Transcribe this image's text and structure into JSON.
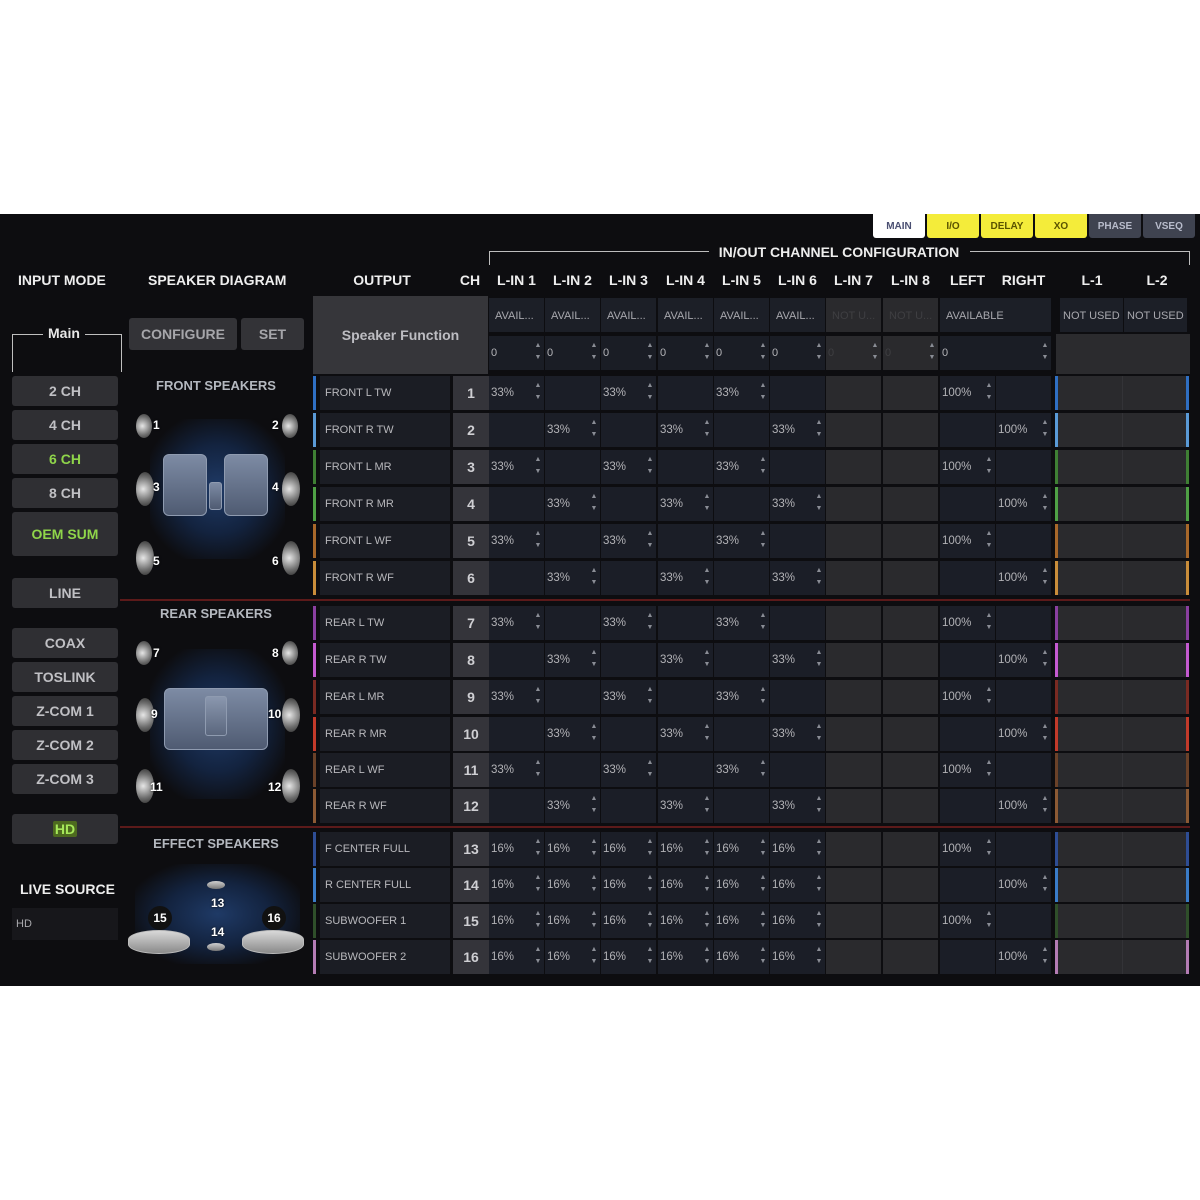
{
  "tabs": [
    {
      "label": "MAIN",
      "style": "white"
    },
    {
      "label": "I/O",
      "style": "yellow"
    },
    {
      "label": "DELAY",
      "style": "yellow"
    },
    {
      "label": "XO",
      "style": "yellow"
    },
    {
      "label": "PHASE",
      "style": "grey"
    },
    {
      "label": "VSEQ",
      "style": "grey"
    }
  ],
  "headers": {
    "input_mode": "INPUT MODE",
    "speaker_diagram": "SPEAKER DIAGRAM",
    "output": "OUTPUT",
    "ch": "CH",
    "inout_config": "IN/OUT CHANNEL CONFIGURATION",
    "speaker_function": "Speaker Function"
  },
  "input_mode": {
    "group_label": "Main",
    "buttons": [
      {
        "label": "2 CH",
        "active": false
      },
      {
        "label": "4 CH",
        "active": false
      },
      {
        "label": "6 CH",
        "active": true
      },
      {
        "label": "8 CH",
        "active": false
      },
      {
        "label": "OEM SUM",
        "active": true
      },
      {
        "label": "LINE",
        "active": false
      },
      {
        "label": "COAX",
        "active": false
      },
      {
        "label": "TOSLINK",
        "active": false
      },
      {
        "label": "Z-COM 1",
        "active": false
      },
      {
        "label": "Z-COM 2",
        "active": false
      },
      {
        "label": "Z-COM 3",
        "active": false
      },
      {
        "label": "HD",
        "active": true
      }
    ],
    "live_source_label": "LIVE SOURCE",
    "live_source_value": "HD"
  },
  "speaker_diagram": {
    "configure_label": "CONFIGURE",
    "set_label": "SET",
    "front_label": "FRONT SPEAKERS",
    "rear_label": "REAR SPEAKERS",
    "effect_label": "EFFECT SPEAKERS",
    "front_numbers": [
      "1",
      "2",
      "3",
      "4",
      "5",
      "6"
    ],
    "rear_numbers": [
      "7",
      "8",
      "9",
      "10",
      "11",
      "12"
    ],
    "effect_numbers": [
      "13",
      "14",
      "15",
      "16"
    ]
  },
  "input_columns": [
    {
      "label": "L-IN 1",
      "status": "AVAIL...",
      "value": "0",
      "enabled": true
    },
    {
      "label": "L-IN 2",
      "status": "AVAIL...",
      "value": "0",
      "enabled": true
    },
    {
      "label": "L-IN 3",
      "status": "AVAIL...",
      "value": "0",
      "enabled": true
    },
    {
      "label": "L-IN 4",
      "status": "AVAIL...",
      "value": "0",
      "enabled": true
    },
    {
      "label": "L-IN 5",
      "status": "AVAIL...",
      "value": "0",
      "enabled": true
    },
    {
      "label": "L-IN 6",
      "status": "AVAIL...",
      "value": "0",
      "enabled": true
    },
    {
      "label": "L-IN 7",
      "status": "NOT U...",
      "value": "0",
      "enabled": false
    },
    {
      "label": "L-IN 8",
      "status": "NOT U...",
      "value": "0",
      "enabled": false
    }
  ],
  "left_right": {
    "left_label": "LEFT",
    "right_label": "RIGHT",
    "status": "AVAILABLE",
    "value": "0"
  },
  "link_columns": [
    {
      "label": "L-1",
      "status": "NOT USED"
    },
    {
      "label": "L-2",
      "status": "NOT USED"
    }
  ],
  "rows": [
    {
      "name": "FRONT L TW",
      "ch": "1",
      "color": "#2f6fc2",
      "inputs": [
        "33%",
        "",
        "33%",
        "",
        "33%",
        "",
        "",
        ""
      ],
      "left": "100%",
      "right": ""
    },
    {
      "name": "FRONT R TW",
      "ch": "2",
      "color": "#5a9ad6",
      "inputs": [
        "",
        "33%",
        "",
        "33%",
        "",
        "33%",
        "",
        ""
      ],
      "left": "",
      "right": "100%"
    },
    {
      "name": "FRONT L MR",
      "ch": "3",
      "color": "#3f7f34",
      "inputs": [
        "33%",
        "",
        "33%",
        "",
        "33%",
        "",
        "",
        ""
      ],
      "left": "100%",
      "right": ""
    },
    {
      "name": "FRONT R MR",
      "ch": "4",
      "color": "#4fa045",
      "inputs": [
        "",
        "33%",
        "",
        "33%",
        "",
        "33%",
        "",
        ""
      ],
      "left": "",
      "right": "100%"
    },
    {
      "name": "FRONT L WF",
      "ch": "5",
      "color": "#a8682a",
      "inputs": [
        "33%",
        "",
        "33%",
        "",
        "33%",
        "",
        "",
        ""
      ],
      "left": "100%",
      "right": ""
    },
    {
      "name": "FRONT R WF",
      "ch": "6",
      "color": "#c98d3a",
      "inputs": [
        "",
        "33%",
        "",
        "33%",
        "",
        "33%",
        "",
        ""
      ],
      "left": "",
      "right": "100%"
    },
    {
      "name": "REAR L TW",
      "ch": "7",
      "color": "#8a3fa0",
      "inputs": [
        "33%",
        "",
        "33%",
        "",
        "33%",
        "",
        "",
        ""
      ],
      "left": "100%",
      "right": ""
    },
    {
      "name": "REAR R TW",
      "ch": "8",
      "color": "#c45ad0",
      "inputs": [
        "",
        "33%",
        "",
        "33%",
        "",
        "33%",
        "",
        ""
      ],
      "left": "",
      "right": "100%"
    },
    {
      "name": "REAR L MR",
      "ch": "9",
      "color": "#7a2a22",
      "inputs": [
        "33%",
        "",
        "33%",
        "",
        "33%",
        "",
        "",
        ""
      ],
      "left": "100%",
      "right": ""
    },
    {
      "name": "REAR R MR",
      "ch": "10",
      "color": "#c23a2a",
      "inputs": [
        "",
        "33%",
        "",
        "33%",
        "",
        "33%",
        "",
        ""
      ],
      "left": "",
      "right": "100%"
    },
    {
      "name": "REAR L WF",
      "ch": "11",
      "color": "#6a4128",
      "inputs": [
        "33%",
        "",
        "33%",
        "",
        "33%",
        "",
        "",
        ""
      ],
      "left": "100%",
      "right": ""
    },
    {
      "name": "REAR R WF",
      "ch": "12",
      "color": "#8c5a34",
      "inputs": [
        "",
        "33%",
        "",
        "33%",
        "",
        "33%",
        "",
        ""
      ],
      "left": "",
      "right": "100%"
    },
    {
      "name": "F CENTER FULL",
      "ch": "13",
      "color": "#2e4d94",
      "inputs": [
        "16%",
        "16%",
        "16%",
        "16%",
        "16%",
        "16%",
        "",
        ""
      ],
      "left": "100%",
      "right": ""
    },
    {
      "name": "R CENTER FULL",
      "ch": "14",
      "color": "#3a7cc8",
      "inputs": [
        "16%",
        "16%",
        "16%",
        "16%",
        "16%",
        "16%",
        "",
        ""
      ],
      "left": "",
      "right": "100%"
    },
    {
      "name": "SUBWOOFER 1",
      "ch": "15",
      "color": "#2f4f2a",
      "inputs": [
        "16%",
        "16%",
        "16%",
        "16%",
        "16%",
        "16%",
        "",
        ""
      ],
      "left": "100%",
      "right": ""
    },
    {
      "name": "SUBWOOFER 2",
      "ch": "16",
      "color": "#b47cb4",
      "inputs": [
        "16%",
        "16%",
        "16%",
        "16%",
        "16%",
        "16%",
        "",
        ""
      ],
      "left": "",
      "right": "100%"
    }
  ]
}
